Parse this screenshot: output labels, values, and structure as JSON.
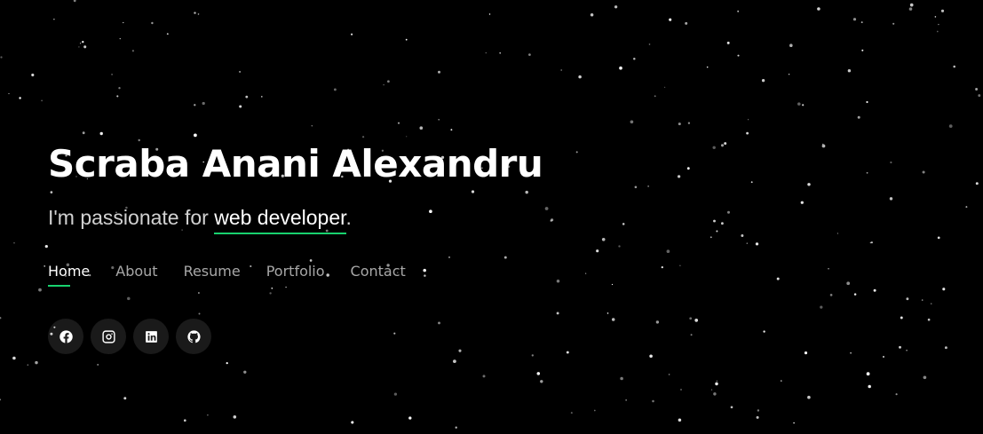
{
  "hero": {
    "name": "Scraba Anani Alexandru",
    "tagline_prefix": "I'm passionate for ",
    "tagline_role": "web developer",
    "tagline_suffix": "."
  },
  "nav": {
    "items": [
      {
        "label": "Home",
        "active": true
      },
      {
        "label": "About"
      },
      {
        "label": "Resume"
      },
      {
        "label": "Portfolio"
      },
      {
        "label": "Contact"
      }
    ]
  },
  "social": [
    {
      "icon": "facebook-icon"
    },
    {
      "icon": "instagram-icon"
    },
    {
      "icon": "linkedin-icon"
    },
    {
      "icon": "github-icon"
    }
  ],
  "colors": {
    "background": "#000000",
    "accent": "#18d26e",
    "text": "#ffffff"
  }
}
